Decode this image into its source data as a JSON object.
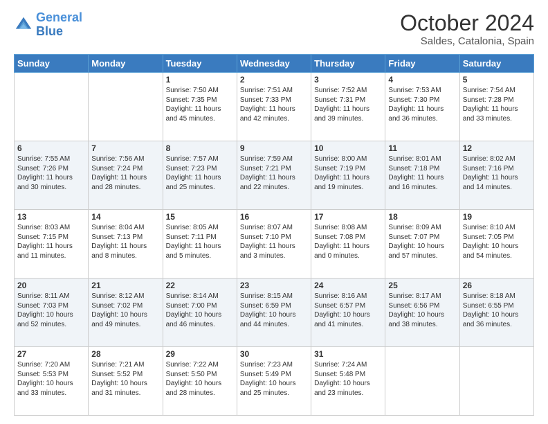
{
  "header": {
    "logo_line1": "General",
    "logo_line2": "Blue",
    "main_title": "October 2024",
    "subtitle": "Saldes, Catalonia, Spain"
  },
  "weekdays": [
    "Sunday",
    "Monday",
    "Tuesday",
    "Wednesday",
    "Thursday",
    "Friday",
    "Saturday"
  ],
  "weeks": [
    [
      {
        "day": "",
        "text": ""
      },
      {
        "day": "",
        "text": ""
      },
      {
        "day": "1",
        "text": "Sunrise: 7:50 AM\nSunset: 7:35 PM\nDaylight: 11 hours\nand 45 minutes."
      },
      {
        "day": "2",
        "text": "Sunrise: 7:51 AM\nSunset: 7:33 PM\nDaylight: 11 hours\nand 42 minutes."
      },
      {
        "day": "3",
        "text": "Sunrise: 7:52 AM\nSunset: 7:31 PM\nDaylight: 11 hours\nand 39 minutes."
      },
      {
        "day": "4",
        "text": "Sunrise: 7:53 AM\nSunset: 7:30 PM\nDaylight: 11 hours\nand 36 minutes."
      },
      {
        "day": "5",
        "text": "Sunrise: 7:54 AM\nSunset: 7:28 PM\nDaylight: 11 hours\nand 33 minutes."
      }
    ],
    [
      {
        "day": "6",
        "text": "Sunrise: 7:55 AM\nSunset: 7:26 PM\nDaylight: 11 hours\nand 30 minutes."
      },
      {
        "day": "7",
        "text": "Sunrise: 7:56 AM\nSunset: 7:24 PM\nDaylight: 11 hours\nand 28 minutes."
      },
      {
        "day": "8",
        "text": "Sunrise: 7:57 AM\nSunset: 7:23 PM\nDaylight: 11 hours\nand 25 minutes."
      },
      {
        "day": "9",
        "text": "Sunrise: 7:59 AM\nSunset: 7:21 PM\nDaylight: 11 hours\nand 22 minutes."
      },
      {
        "day": "10",
        "text": "Sunrise: 8:00 AM\nSunset: 7:19 PM\nDaylight: 11 hours\nand 19 minutes."
      },
      {
        "day": "11",
        "text": "Sunrise: 8:01 AM\nSunset: 7:18 PM\nDaylight: 11 hours\nand 16 minutes."
      },
      {
        "day": "12",
        "text": "Sunrise: 8:02 AM\nSunset: 7:16 PM\nDaylight: 11 hours\nand 14 minutes."
      }
    ],
    [
      {
        "day": "13",
        "text": "Sunrise: 8:03 AM\nSunset: 7:15 PM\nDaylight: 11 hours\nand 11 minutes."
      },
      {
        "day": "14",
        "text": "Sunrise: 8:04 AM\nSunset: 7:13 PM\nDaylight: 11 hours\nand 8 minutes."
      },
      {
        "day": "15",
        "text": "Sunrise: 8:05 AM\nSunset: 7:11 PM\nDaylight: 11 hours\nand 5 minutes."
      },
      {
        "day": "16",
        "text": "Sunrise: 8:07 AM\nSunset: 7:10 PM\nDaylight: 11 hours\nand 3 minutes."
      },
      {
        "day": "17",
        "text": "Sunrise: 8:08 AM\nSunset: 7:08 PM\nDaylight: 11 hours\nand 0 minutes."
      },
      {
        "day": "18",
        "text": "Sunrise: 8:09 AM\nSunset: 7:07 PM\nDaylight: 10 hours\nand 57 minutes."
      },
      {
        "day": "19",
        "text": "Sunrise: 8:10 AM\nSunset: 7:05 PM\nDaylight: 10 hours\nand 54 minutes."
      }
    ],
    [
      {
        "day": "20",
        "text": "Sunrise: 8:11 AM\nSunset: 7:03 PM\nDaylight: 10 hours\nand 52 minutes."
      },
      {
        "day": "21",
        "text": "Sunrise: 8:12 AM\nSunset: 7:02 PM\nDaylight: 10 hours\nand 49 minutes."
      },
      {
        "day": "22",
        "text": "Sunrise: 8:14 AM\nSunset: 7:00 PM\nDaylight: 10 hours\nand 46 minutes."
      },
      {
        "day": "23",
        "text": "Sunrise: 8:15 AM\nSunset: 6:59 PM\nDaylight: 10 hours\nand 44 minutes."
      },
      {
        "day": "24",
        "text": "Sunrise: 8:16 AM\nSunset: 6:57 PM\nDaylight: 10 hours\nand 41 minutes."
      },
      {
        "day": "25",
        "text": "Sunrise: 8:17 AM\nSunset: 6:56 PM\nDaylight: 10 hours\nand 38 minutes."
      },
      {
        "day": "26",
        "text": "Sunrise: 8:18 AM\nSunset: 6:55 PM\nDaylight: 10 hours\nand 36 minutes."
      }
    ],
    [
      {
        "day": "27",
        "text": "Sunrise: 7:20 AM\nSunset: 5:53 PM\nDaylight: 10 hours\nand 33 minutes."
      },
      {
        "day": "28",
        "text": "Sunrise: 7:21 AM\nSunset: 5:52 PM\nDaylight: 10 hours\nand 31 minutes."
      },
      {
        "day": "29",
        "text": "Sunrise: 7:22 AM\nSunset: 5:50 PM\nDaylight: 10 hours\nand 28 minutes."
      },
      {
        "day": "30",
        "text": "Sunrise: 7:23 AM\nSunset: 5:49 PM\nDaylight: 10 hours\nand 25 minutes."
      },
      {
        "day": "31",
        "text": "Sunrise: 7:24 AM\nSunset: 5:48 PM\nDaylight: 10 hours\nand 23 minutes."
      },
      {
        "day": "",
        "text": ""
      },
      {
        "day": "",
        "text": ""
      }
    ]
  ]
}
